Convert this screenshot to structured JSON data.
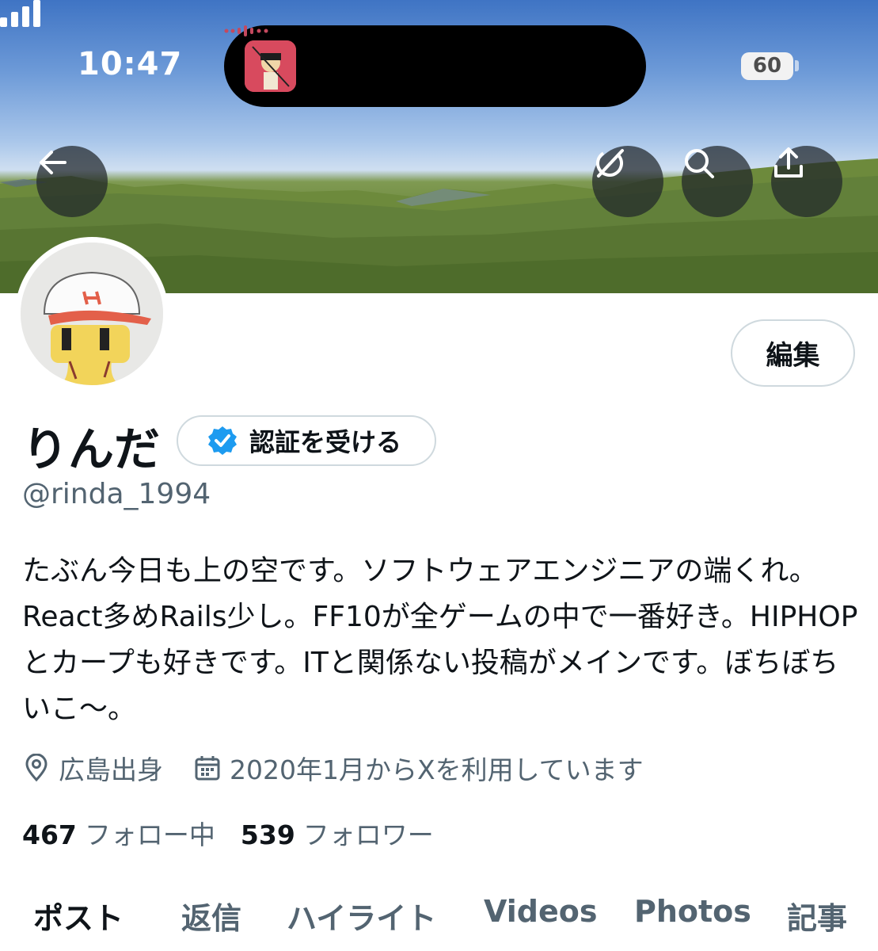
{
  "status_bar": {
    "time": "10:47",
    "battery": "60"
  },
  "header": {
    "back_icon": "arrow-left-icon",
    "actions": [
      "grok-icon",
      "search-icon",
      "share-icon"
    ]
  },
  "profile": {
    "display_name": "りんだ",
    "verify_label": "認証を受ける",
    "handle": "@rinda_1994",
    "edit_label": "編集",
    "bio": "たぶん今日も上の空です。ソフトウェアエンジニアの端くれ。React多めRails少し。FF10が全ゲームの中で一番好き。HIPHOPとカープも好きです。ITと関係ない投稿がメインです。ぼちぼちいこ〜。",
    "location": "広島出身",
    "joined": "2020年1月からXを利用しています",
    "following_count": "467",
    "following_label": "フォロー中",
    "followers_count": "539",
    "followers_label": "フォロワー"
  },
  "tabs": [
    {
      "label": "ポスト",
      "active": true
    },
    {
      "label": "返信",
      "active": false
    },
    {
      "label": "ハイライト",
      "active": false
    },
    {
      "label": "Videos",
      "active": false
    },
    {
      "label": "Photos",
      "active": false
    },
    {
      "label": "記事",
      "active": false
    }
  ],
  "colors": {
    "verified_blue": "#1d9bf0",
    "secondary_text": "#536471",
    "primary_text": "#0f1419"
  }
}
